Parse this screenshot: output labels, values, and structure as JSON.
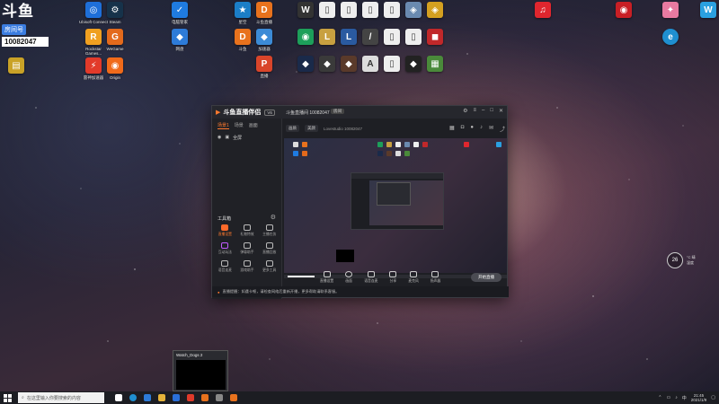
{
  "douyu": {
    "logo": "斗鱼",
    "room_tag": "房间号",
    "room_number": "10082047"
  },
  "desktop_icons": [
    {
      "id": "ubisoft",
      "label": "Ubisoft Connect",
      "color": "#1e6fd9",
      "glyph": "◎"
    },
    {
      "id": "steam",
      "label": "Steam",
      "color": "#16324a",
      "glyph": "⚙"
    },
    {
      "id": "rockstar",
      "label": "Rockstar Games...",
      "color": "#f0a020",
      "glyph": "R"
    },
    {
      "id": "wegame",
      "label": "WeGame",
      "color": "#e36a1c",
      "glyph": "G"
    },
    {
      "id": "leigod",
      "label": "雷神加速器",
      "color": "#e23a2a",
      "glyph": "⚡"
    },
    {
      "id": "origin",
      "label": "Origin",
      "color": "#f06a1a",
      "glyph": "◉"
    },
    {
      "id": "security",
      "label": "电脑管家",
      "color": "#1f7be0",
      "glyph": "✓"
    },
    {
      "id": "netdisk",
      "label": "网盘",
      "color": "#2d7bd8",
      "glyph": "◆"
    },
    {
      "id": "app-star",
      "label": "星空",
      "color": "#1b7ec7",
      "glyph": "★"
    },
    {
      "id": "douyu-live",
      "label": "斗鱼直播",
      "color": "#e8721d",
      "glyph": "D"
    },
    {
      "id": "app-orange2",
      "label": "斗鱼",
      "color": "#e8721d",
      "glyph": "D"
    },
    {
      "id": "app-blue2",
      "label": "加速器",
      "color": "#3c8bd6",
      "glyph": "◆"
    },
    {
      "id": "app-pin",
      "label": "直播",
      "color": "#d9452a",
      "glyph": "P"
    }
  ],
  "app": {
    "brand": "斗鱼直播伴侣",
    "version": "V6",
    "room_title": "斗鱼直播间 10082047",
    "room_button": "房间",
    "scene_tabs": [
      "场景1",
      "场景",
      "画面"
    ],
    "scene_item": "全屏",
    "tools_title": "工具箱",
    "tools": [
      {
        "label": "直播设置",
        "active": true
      },
      {
        "label": "礼物特效",
        "active": false
      },
      {
        "label": "主播任务",
        "active": false
      },
      {
        "label": "互动玩法",
        "active": false
      },
      {
        "label": "弹幕助手",
        "active": false
      },
      {
        "label": "直播回放",
        "active": false
      },
      {
        "label": "语音连麦",
        "active": false
      },
      {
        "label": "游戏助手",
        "active": false
      },
      {
        "label": "更多工具",
        "active": false
      },
      {
        "label": "设置",
        "active": false
      },
      {
        "label": "粉丝",
        "active": false
      },
      {
        "label": "排行",
        "active": false
      }
    ],
    "header_buttons": [
      "画质",
      "美颜"
    ],
    "header_text": "Lovestudio 10082047",
    "live_controls": [
      "直播设置",
      "画面",
      "语音连麦",
      "分享",
      "麦克风",
      "扬声器"
    ],
    "start_live": "开始直播",
    "notice": "直播提醒：如遇卡顿，请检查网络后重新开播，更多帮助请联系客服。"
  },
  "clock_widget": {
    "value": "26",
    "line1": "°C 晴",
    "line2": "湿度"
  },
  "thumbnail": {
    "title": "Watch_Dogs 2"
  },
  "taskbar": {
    "search_placeholder": "在这里输入你要搜索的内容",
    "time": "21:45",
    "date": "2021/1/9"
  }
}
